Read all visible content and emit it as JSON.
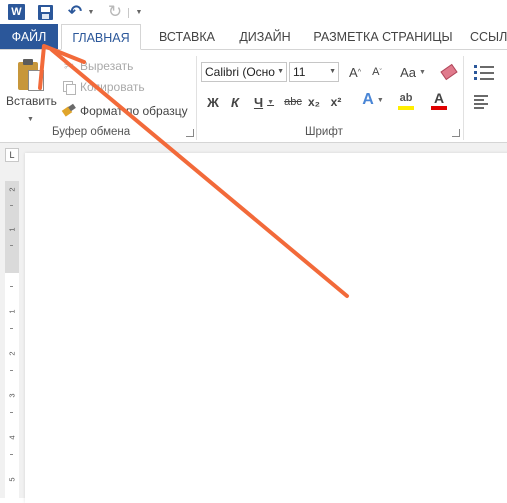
{
  "quick_access": {
    "word_logo": "W"
  },
  "tabs": [
    {
      "label": "ФАЙЛ"
    },
    {
      "label": "ГЛАВНАЯ"
    },
    {
      "label": "ВСТАВКА"
    },
    {
      "label": "ДИЗАЙН"
    },
    {
      "label": "РАЗМЕТКА СТРАНИЦЫ"
    },
    {
      "label": "ССЫЛ"
    }
  ],
  "clipboard": {
    "paste_label": "Вставить",
    "cut_label": "Вырезать",
    "copy_label": "Копировать",
    "format_painter_label": "Формат по образцу",
    "group_label": "Буфер обмена"
  },
  "font": {
    "font_name": "Calibri (Осно",
    "font_size": "11",
    "case_label": "Aa",
    "bold": "Ж",
    "italic": "К",
    "underline": "Ч",
    "strike": "abc",
    "subscript": "x₂",
    "superscript": "x²",
    "effects": "A",
    "highlight_letter": "ab",
    "color_letter": "A",
    "group_label": "Шрифт"
  },
  "ruler": {
    "corner_symbol": "L",
    "numbers": [
      "2",
      "1",
      "1",
      "2",
      "3",
      "4",
      "5"
    ]
  },
  "colors": {
    "accent": "#2b579a",
    "annotation_arrow": "#f26a3a"
  }
}
